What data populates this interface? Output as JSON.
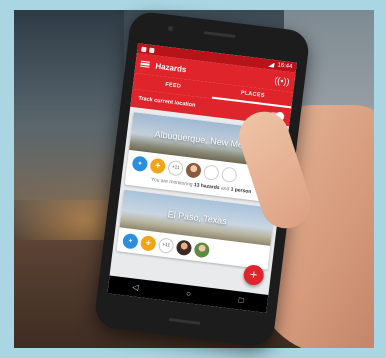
{
  "status_bar": {
    "time": "16:44"
  },
  "app_bar": {
    "title": "Hazards",
    "menu_icon": "hamburger-menu-icon",
    "broadcast_icon": "wireless-broadcast-icon"
  },
  "tabs": [
    {
      "label": "FEED",
      "active": false
    },
    {
      "label": "PLACES",
      "active": true
    }
  ],
  "track_location": {
    "label": "Track current location",
    "enabled": true
  },
  "places": [
    {
      "name": "Albuquerque, New Mexico",
      "chips": [
        "blue-hazard",
        "orange-hazard",
        "+11",
        "person",
        "empty",
        "empty"
      ],
      "more_label": "+11",
      "summary_prefix": "You are monitoring ",
      "summary_hazards": "13 hazards",
      "summary_mid": " and ",
      "summary_people": "1 person"
    },
    {
      "name": "El Paso, Texas",
      "chips": [
        "blue-hazard",
        "orange-hazard",
        "+11",
        "person",
        "person"
      ],
      "more_label": "+11"
    }
  ],
  "fab": {
    "label": "+"
  },
  "nav": {
    "back": "◁",
    "home": "○",
    "recent": "□"
  },
  "colors": {
    "primary": "#e0242b",
    "status": "#b9131a",
    "hazard_blue": "#2b8fe0",
    "hazard_orange": "#f0a418"
  }
}
